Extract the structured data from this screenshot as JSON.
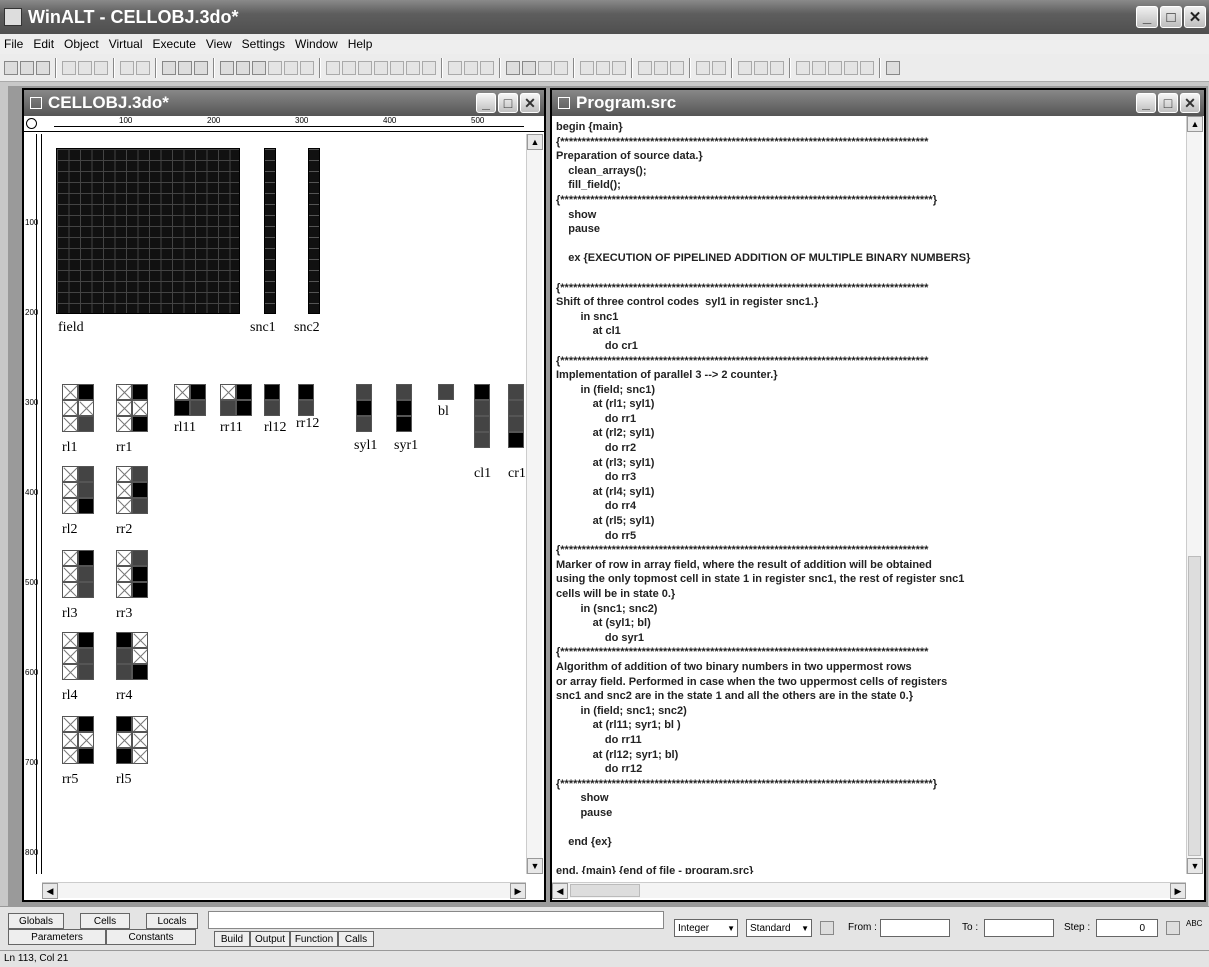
{
  "app": {
    "title": "WinALT - CELLOBJ.3do*"
  },
  "menu": [
    "File",
    "Edit",
    "Object",
    "Virtual",
    "Execute",
    "View",
    "Settings",
    "Window",
    "Help"
  ],
  "left_window": {
    "title": "CELLOBJ.3do*",
    "hruler": [
      "100",
      "200",
      "300",
      "400",
      "500"
    ],
    "vruler": [
      "100",
      "200",
      "300",
      "400",
      "500",
      "600",
      "700",
      "800"
    ],
    "labels": {
      "field": "field",
      "snc1": "snc1",
      "snc2": "snc2",
      "rl1": "rl1",
      "rr1": "rr1",
      "rl11": "rl11",
      "rr11": "rr11",
      "rl12": "rl12",
      "rr12": "rr12",
      "syl1": "syl1",
      "syr1": "syr1",
      "bl": "bl",
      "cl1": "cl1",
      "cr1": "cr1",
      "rl2": "rl2",
      "rr2": "rr2",
      "rl3": "rl3",
      "rr3": "rr3",
      "rl4": "rl4",
      "rr4": "rr4",
      "rr5": "rr5",
      "rl5": "rl5"
    }
  },
  "right_window": {
    "title": "Program.src",
    "code": "begin {main}\n{**************************************************************************************\nPreparation of source data.}\n    clean_arrays();\n    fill_field();\n{***************************************************************************************}\n    show\n    pause\n\n    ex {EXECUTION OF PIPELINED ADDITION OF MULTIPLE BINARY NUMBERS}\n\n{**************************************************************************************\nShift of three control codes  syl1 in register snc1.}\n        in snc1\n            at cl1\n                do cr1\n{**************************************************************************************\nImplementation of parallel 3 --> 2 counter.}\n        in (field; snc1)\n            at (rl1; syl1)\n                do rr1\n            at (rl2; syl1)\n                do rr2\n            at (rl3; syl1)\n                do rr3\n            at (rl4; syl1)\n                do rr4\n            at (rl5; syl1)\n                do rr5\n{**************************************************************************************\nMarker of row in array field, where the result of addition will be obtained\nusing the only topmost cell in state 1 in register snc1, the rest of register snc1\ncells will be in state 0.}\n        in (snc1; snc2)\n            at (syl1; bl)\n                do syr1\n{**************************************************************************************\nAlgorithm of addition of two binary numbers in two uppermost rows\nor array field. Performed in case when the two uppermost cells of registers\nsnc1 and snc2 are in the state 1 and all the others are in the state 0.}\n        in (field; snc1; snc2)\n            at (rl11; syr1; bl )\n                do rr11\n            at (rl12; syr1; bl)\n                do rr12\n{***************************************************************************************}\n        show\n        pause\n\n    end {ex}\n\nend. {main} {end of file - program.src}"
  },
  "bottom": {
    "tabs_top": [
      "Globals",
      "Cells",
      "Locals"
    ],
    "tabs_bottom": [
      "Parameters",
      "Constants"
    ],
    "out_tabs": [
      "Build",
      "Output",
      "Function",
      "Calls"
    ],
    "type": "Integer",
    "mode": "Standard",
    "from_label": "From :",
    "to_label": "To :",
    "step_label": "Step :",
    "step_value": "0",
    "abc": "ABC"
  },
  "status": "Ln 113, Col 21"
}
